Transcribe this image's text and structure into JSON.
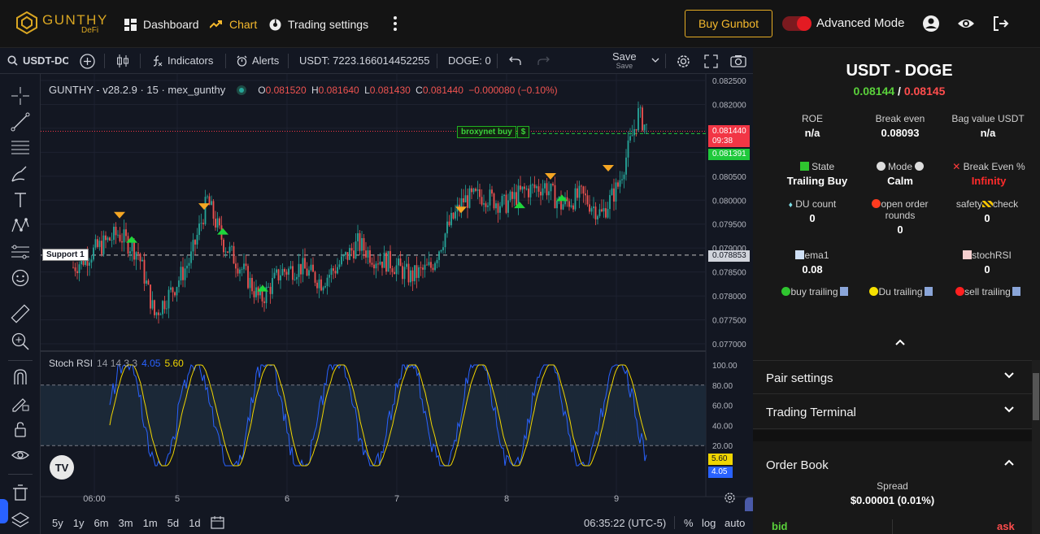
{
  "nav": {
    "logo_text": "GUNTHY",
    "logo_sub": "DeFi",
    "items": [
      "Dashboard",
      "Chart",
      "Trading settings"
    ],
    "buy_button": "Buy Gunbot",
    "mode_label": "Advanced Mode"
  },
  "toolbar": {
    "symbol": "USDT-DOGE",
    "indicators": "Indicators",
    "alerts": "Alerts",
    "usdt_balance": "USDT: 7223.166014452255",
    "doge_balance": "DOGE: 0",
    "save": "Save",
    "save_sub": "Save"
  },
  "legend": {
    "title": "GUNTHY - v28.2.9 · 15 · mex_gunthy",
    "o_label": "O",
    "o": "0.081520",
    "h_label": "H",
    "h": "0.081640",
    "l_label": "L",
    "l": "0.081430",
    "c_label": "C",
    "c": "0.081440",
    "change": "−0.000080 (−0.10%)",
    "stoch": "Stoch RSI",
    "stoch_params": "14 14 3 3",
    "stoch_k": "4.05",
    "stoch_d": "5.60"
  },
  "price_axis": [
    "0.082500",
    "0.082000",
    "0.081500",
    "0.081000",
    "0.080500",
    "0.080000",
    "0.079500",
    "0.079000",
    "0.078500",
    "0.078000",
    "0.077500",
    "0.077000"
  ],
  "price_tags": {
    "last": "0.081440",
    "countdown": "09:38",
    "green": "0.081391",
    "support": "0.078853",
    "support_label": "Support 1",
    "broxynet_label": "broxynet buy",
    "broxynet_mark": "$"
  },
  "stoch_axis": [
    "100.00",
    "80.00",
    "60.00",
    "40.00",
    "20.00"
  ],
  "stoch_tags": {
    "d": "5.60",
    "k": "4.05"
  },
  "time_axis": [
    "06:00",
    "5",
    "6",
    "7",
    "8",
    "9"
  ],
  "bottombar": {
    "ranges": [
      "5y",
      "1y",
      "6m",
      "3m",
      "1m",
      "5d",
      "1d"
    ],
    "clock": "06:35:22 (UTC-5)",
    "percent": "%",
    "log": "log",
    "auto": "auto"
  },
  "panel": {
    "pair": "USDT - DOGE",
    "bid_price": "0.08144",
    "slash": "/",
    "ask_price": "0.08145",
    "stats": [
      {
        "label": "ROE",
        "value": "n/a"
      },
      {
        "label": "Break even",
        "value": "0.08093"
      },
      {
        "label": "Bag value USDT",
        "value": "n/a"
      }
    ],
    "state_label": "State",
    "state_value": "Trailing Buy",
    "mode_label": "Mode",
    "mode_value": "Calm",
    "be_label": "Break Even %",
    "be_value": "Infinity",
    "du_label": "DU count",
    "du_value": "0",
    "open_label1": "open order",
    "open_label2": "rounds",
    "open_value": "0",
    "safety_label1": "safety",
    "safety_label2": "check",
    "safety_value": "0",
    "ema_label": "ema1",
    "ema_value": "0.08",
    "stoch_label": "stochRSI",
    "stoch_value": "0",
    "trail_buy": "buy trailing",
    "trail_du": "Du trailing",
    "trail_sell": "sell trailing",
    "pair_settings": "Pair settings",
    "trading_terminal": "Trading Terminal",
    "order_book": "Order Book",
    "spread_label": "Spread",
    "spread_value": "$0.00001 (0.01%)",
    "bid": "bid",
    "ask": "ask"
  },
  "colors": {
    "accent": "#f5b92d",
    "up": "#26a69a",
    "down": "#ef5350",
    "bid": "#5ad13b",
    "ask": "#ff4d4d"
  }
}
